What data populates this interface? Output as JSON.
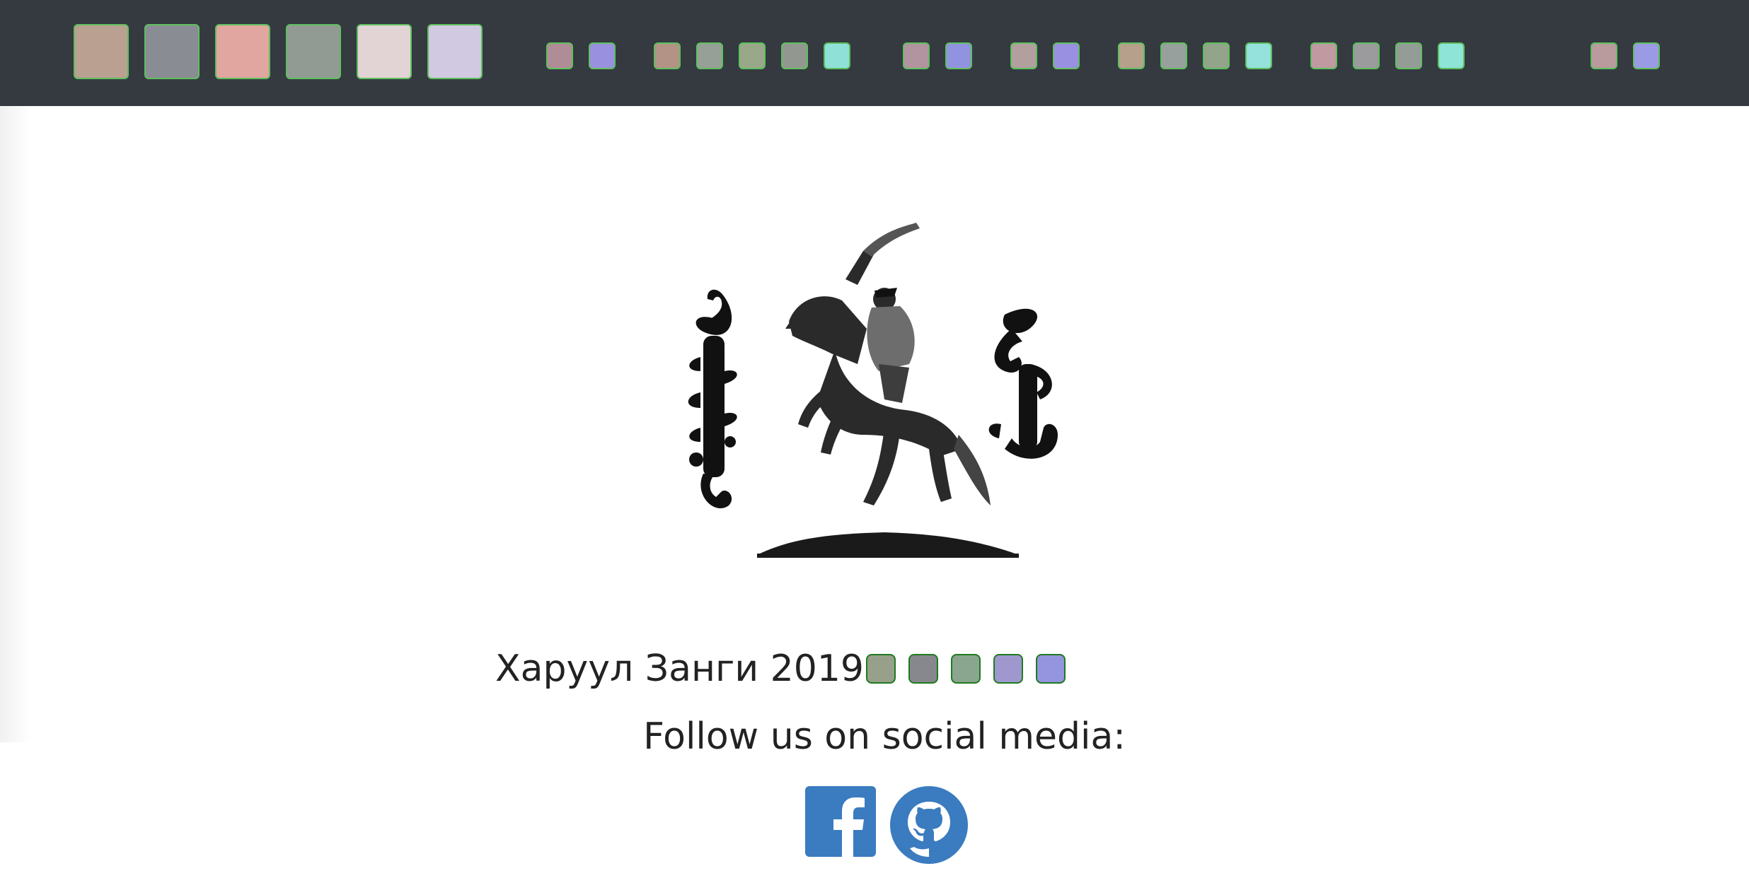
{
  "footer": {
    "copyright": "Харуул Занги 2019",
    "follow_text": "Follow us on social media:"
  },
  "social": {
    "facebook": {
      "icon": "facebook-icon",
      "color": "#3b7bbf"
    },
    "github": {
      "icon": "github-icon",
      "color": "#3b7bbf"
    }
  },
  "colors": {
    "topbar_background": "#343a40",
    "swatch_border": "#5ec05e",
    "page_background": "#ffffff",
    "text": "#222222"
  },
  "topbar": {
    "large_swatches": [
      "#b9a090",
      "#8a8c94",
      "#e1a69f",
      "#929a94",
      "#e2d3d5",
      "#d1c9e1"
    ],
    "small_swatches": [
      "#b08c96",
      "#9a90e0",
      "#b39385",
      "#97a096",
      "#9aa88a",
      "#929790",
      "#8fe1d7",
      "#b294a0",
      "#9192e0",
      "#b2a09f",
      "#9a90e2",
      "#b6a08c",
      "#97a09d",
      "#92a48a",
      "#95e1dc",
      "#c09aa0",
      "#9b9a9d",
      "#949c98",
      "#8fe4d8",
      "#b99a9d",
      "#9b9ae5"
    ]
  },
  "footer_swatches": [
    "#97a08a",
    "#87888e",
    "#8aa68e",
    "#9e98cf",
    "#9594df"
  ]
}
